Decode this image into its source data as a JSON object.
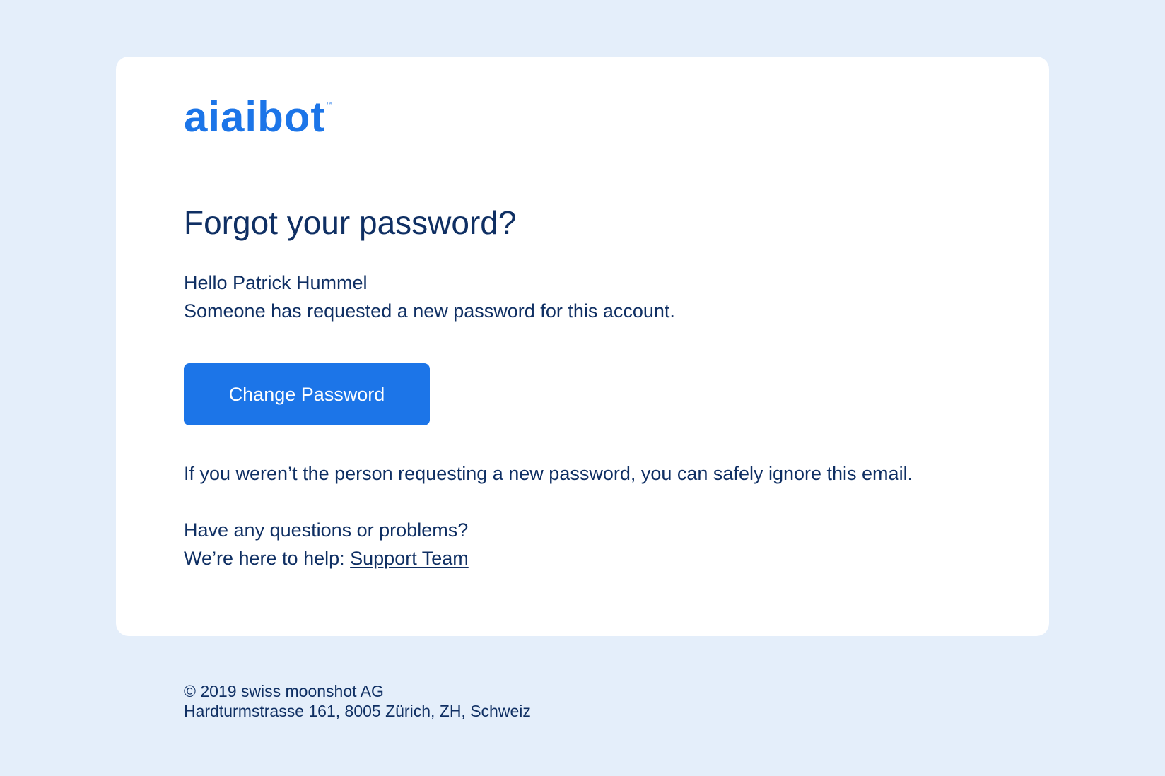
{
  "brand": {
    "logo_text": "aiaibot",
    "trademark": "™",
    "accent_color": "#1c75e8",
    "text_color": "#0f2f63",
    "background_color": "#e4eefa"
  },
  "email": {
    "title": "Forgot your password?",
    "greeting": "Hello Patrick Hummel",
    "request_message": "Someone has requested a new password for this account.",
    "cta_label": "Change Password",
    "ignore_message": "If you weren’t the person requesting a new password, you can safely ignore this email.",
    "questions_text": "Have any questions or problems?",
    "help_prefix": "We’re here to help: ",
    "support_link_label": "Support Team"
  },
  "footer": {
    "copyright": "© 2019 swiss moonshot AG",
    "address": "Hardturmstrasse 161, 8005 Zürich, ZH, Schweiz"
  }
}
